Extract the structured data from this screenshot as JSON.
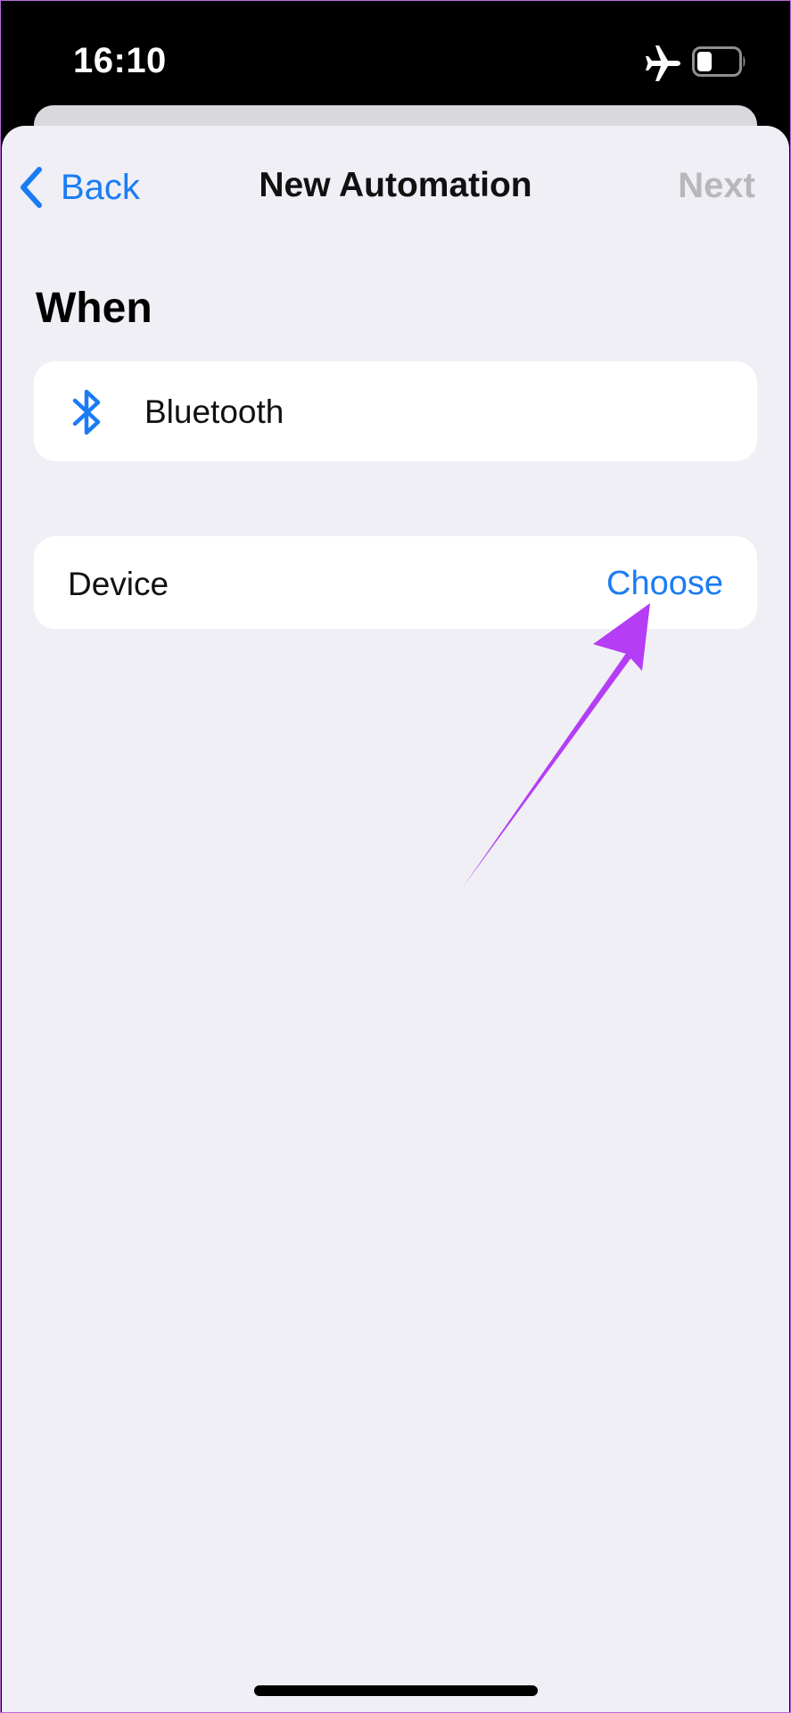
{
  "status_bar": {
    "time": "16:10",
    "icons": [
      "airplane-icon",
      "battery-icon"
    ]
  },
  "nav": {
    "back_label": "Back",
    "title": "New Automation",
    "next_label": "Next",
    "next_enabled": false
  },
  "section": {
    "heading": "When"
  },
  "trigger": {
    "icon": "bluetooth-icon",
    "label": "Bluetooth"
  },
  "device_row": {
    "label": "Device",
    "action_label": "Choose"
  },
  "colors": {
    "accent": "#1a7cf5",
    "disabled": "#b8b8bc",
    "background": "#f0eff5",
    "annotation": "#b53df5"
  }
}
